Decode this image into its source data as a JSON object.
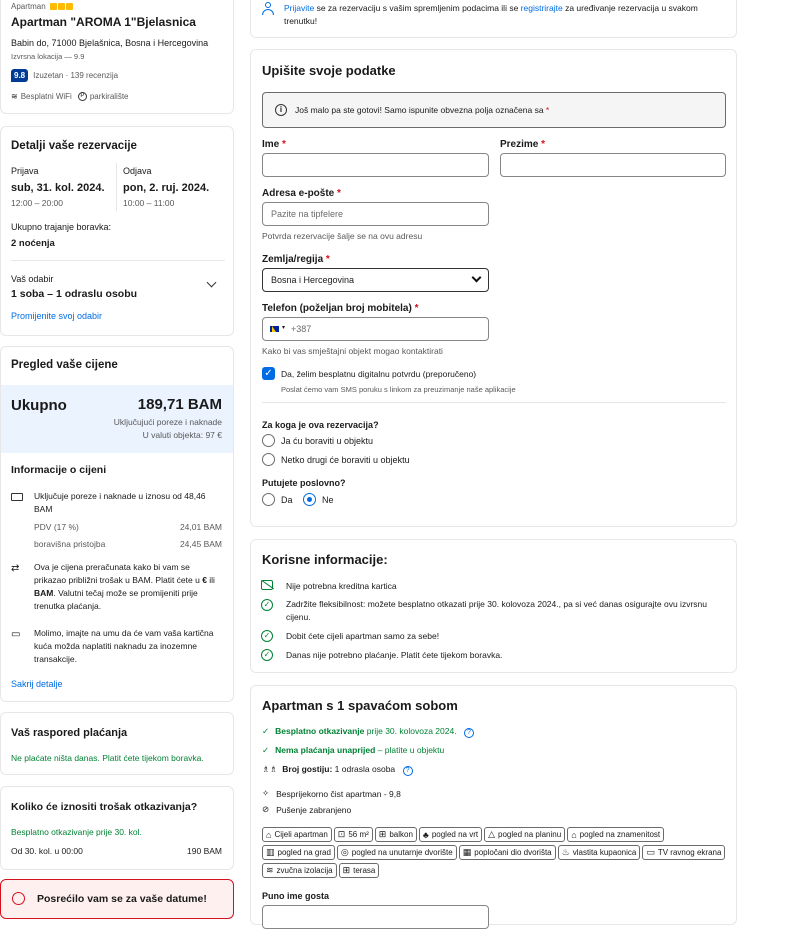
{
  "hotel": {
    "type": "Apartman",
    "name": "Apartman \"AROMA 1\"Bjelasnica",
    "address": "Babin do, 71000 Bjelašnica, Bosna i Hercegovina",
    "location_note": "Izvrsna lokacija — 9.9",
    "score": "9.8",
    "score_text": "Izuzetan · 139 recenzija",
    "amenity_wifi": "Besplatni WiFi",
    "amenity_parking": "parkiralište"
  },
  "booking": {
    "title": "Detalji vaše rezervacije",
    "checkin_label": "Prijava",
    "checkin_date": "sub, 31. kol. 2024.",
    "checkin_time": "12:00 – 20:00",
    "checkout_label": "Odjava",
    "checkout_date": "pon, 2. ruj. 2024.",
    "checkout_time": "10:00 – 11:00",
    "duration_label": "Ukupno trajanje boravka:",
    "duration_value": "2 noćenja",
    "selection_label": "Vaš odabir",
    "selection_value": "1 soba – 1 odraslu osobu",
    "change_link": "Promijenite svoj odabir"
  },
  "price": {
    "title": "Pregled vaše cijene",
    "total_label": "Ukupno",
    "total_value": "189,71 BAM",
    "taxes_note": "Uključujući poreze i naknade",
    "property_currency": "U valuti objekta: 97 €",
    "info_title": "Informacije o cijeni",
    "includes": "Uključuje poreze i naknade u iznosu od 48,46 BAM",
    "vat_label": "PDV (17 %)",
    "vat_value": "24,01 BAM",
    "tax_label": "boravišna pristojba",
    "tax_value": "24,45 BAM",
    "currency_note_1": "Ova je cijena preračunata kako bi vam se prikazao približni trošak u BAM. Platit ćete u ",
    "currency_note_eur": "€",
    "currency_note_2": " ili ",
    "currency_note_bam": "BAM",
    "currency_note_3": ". Valutni tečaj može se promijeniti prije trenutka plaćanja.",
    "card_note": "Molimo, imajte na umu da će vam vaša kartična kuća možda naplatiti naknadu za inozemne transakcije.",
    "hide_link": "Sakrij detalje"
  },
  "payment": {
    "title": "Vaš raspored plaćanja",
    "text": "Ne plaćate ništa danas. Platit ćete tijekom boravka."
  },
  "cancel": {
    "title": "Koliko će iznositi trošak otkazivanja?",
    "free": "Besplatno otkazivanje prije 30. kol.",
    "from_label": "Od 30. kol. u 00:00",
    "from_value": "190 BAM"
  },
  "alert": {
    "text": "Posrećilo vam se za vaše datume!"
  },
  "signin": {
    "link1": "Prijavite",
    "mid": " se za rezervaciju s vašim spremljenim podacima ili se ",
    "link2": "registrirajte",
    "end": " za uređivanje rezervacija u svakom trenutku!"
  },
  "form": {
    "title": "Upišite svoje podatke",
    "info": "Još malo pa ste gotovi! Samo ispunite obvezna polja označena sa",
    "first_name_label": "Ime",
    "last_name_label": "Prezime",
    "email_label": "Adresa e-pošte",
    "email_placeholder": "Pazite na tipfelere",
    "email_help": "Potvrda rezervacije šalje se na ovu adresu",
    "country_label": "Zemlja/regija",
    "country_value": "Bosna i Hercegovina",
    "phone_label": "Telefon (poželjan broj mobitela)",
    "phone_prefix": "+387",
    "phone_help": "Kako bi vas smještajni objekt mogao kontaktirati",
    "digital_label": "Da, želim besplatnu digitalnu potvrdu (preporučeno)",
    "digital_help": "Poslat ćemo vam SMS poruku s linkom za preuzimanje naše aplikacije",
    "for_whom_label": "Za koga je ova rezervacija?",
    "for_me": "Ja ću boraviti u objektu",
    "for_other": "Netko drugi će boraviti u objektu",
    "business_label": "Putujete poslovno?",
    "business_yes": "Da",
    "business_no": "Ne",
    "asterisk": "*"
  },
  "useful": {
    "title": "Korisne informacije:",
    "items": [
      "Nije potrebna kreditna kartica",
      "Zadržite fleksibilnost: možete besplatno otkazati prije 30. kolovoza 2024., pa si već danas osigurajte ovu izvrsnu cijenu.",
      "Dobit ćete cijeli apartman samo za sebe!",
      "Danas nije potrebno plaćanje. Platit ćete tijekom boravka."
    ]
  },
  "room": {
    "title": "Apartman s 1 spavaćom sobom",
    "free_cancel_bold": "Besplatno otkazivanje",
    "free_cancel_rest": " prije 30. kolovoza 2024.",
    "no_prepay_bold": "Nema plaćanja unaprijed",
    "no_prepay_rest": " – platite u objektu",
    "guests_bold": "Broj gostiju:",
    "guests_rest": " 1 odrasla osoba",
    "clean": "Besprijekorno čist apartman - 9,8",
    "no_smoking": "Pušenje zabranjeno",
    "tags": [
      "Cijeli apartman",
      "56 m²",
      "balkon",
      "pogled na vrt",
      "pogled na planinu",
      "pogled na znamenitost",
      "pogled na grad",
      "pogled na unutarnje dvorište",
      "popločani dio dvorišta",
      "vlastita kupaonica",
      "TV ravnog ekrana",
      "zvučna izolacija",
      "terasa"
    ],
    "guest_name_label": "Puno ime gosta"
  },
  "colors": {
    "accent": "#006ce4",
    "green": "#008234",
    "navy": "#003b95",
    "price_bg": "#ebf3ff",
    "alert": "#d4111e"
  }
}
